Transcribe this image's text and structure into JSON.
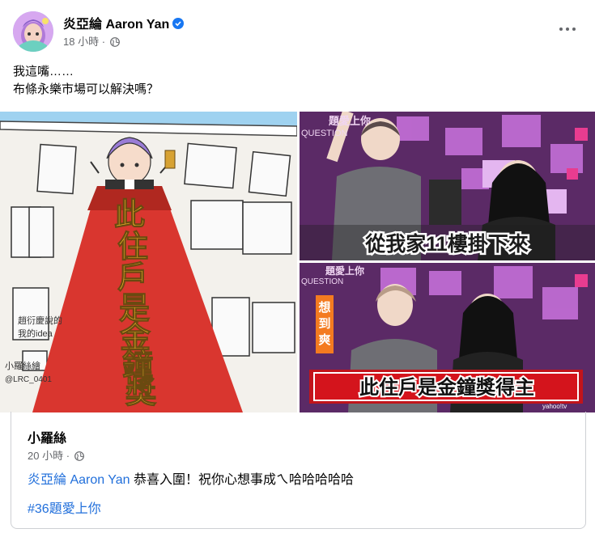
{
  "post": {
    "author": "炎亞綸 Aaron Yan",
    "time": "18 小時",
    "separator": "·",
    "text_line1": "我這嘴……",
    "text_line2": "布條永樂市場可以解決嗎？"
  },
  "media": {
    "left_banner_text": "此住戶是金鐘獎得主",
    "left_signature1": "小羅絲繪",
    "left_signature2": "@LRC_0401",
    "left_small_note1": "趙衍慶說的",
    "left_small_note2": "我的idea",
    "right_top_logo": "題愛上你",
    "right_top_logo_sub": "QUESTION",
    "right_top_caption": "從我家11樓掛下來",
    "right_bot_logo": "題愛上你",
    "right_bot_logo_sub": "QUESTION",
    "right_bot_badge": "想到爽",
    "right_bot_caption": "此住戶是金鐘獎得主",
    "right_bot_watermark": "yahoo!tv"
  },
  "shared": {
    "author": "小羅絲",
    "time": "20 小時",
    "separator": "·",
    "mention": "炎亞綸 Aaron Yan",
    "text_rest": " 恭喜入圍！祝你心想事成ㄟ哈哈哈哈哈",
    "hashtag": "#36題愛上你"
  },
  "colors": {
    "link": "#216fdb",
    "meta": "#65676b",
    "verified": "#1877f2",
    "carpet": "#d9362f",
    "caption_text": "#d4141c"
  },
  "icons": [
    "verified-badge-icon",
    "globe-icon",
    "more-options-icon"
  ]
}
